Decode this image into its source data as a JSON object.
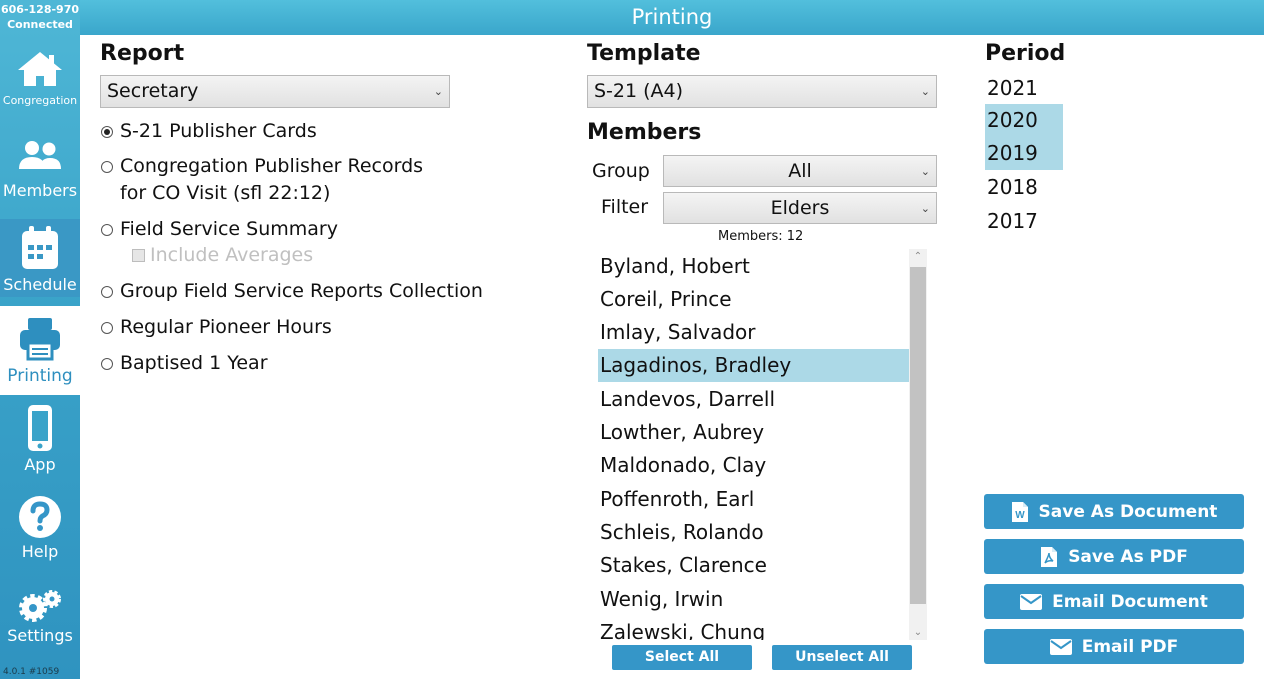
{
  "connection": {
    "id": "606-128-970",
    "status": "Connected"
  },
  "window": {
    "title": "Printing"
  },
  "nav": [
    {
      "label": "Congregation",
      "icon": "home-icon"
    },
    {
      "label": "Members",
      "icon": "people-icon"
    },
    {
      "label": "Schedule",
      "icon": "calendar-icon"
    },
    {
      "label": "Printing",
      "icon": "printer-icon",
      "active": true
    },
    {
      "label": "App",
      "icon": "phone-icon"
    },
    {
      "label": "Help",
      "icon": "help-icon"
    },
    {
      "label": "Settings",
      "icon": "gear-icon"
    }
  ],
  "version": "4.0.1 #1059",
  "report": {
    "heading": "Report",
    "selected": "Secretary",
    "options": [
      {
        "label": "S-21 Publisher Cards",
        "checked": true
      },
      {
        "label": "Congregation Publisher Records",
        "label2": "for CO Visit (sfl 22:12)",
        "checked": false
      },
      {
        "label": "Field Service Summary",
        "checked": false
      },
      {
        "label": "Group Field Service Reports Collection",
        "checked": false
      },
      {
        "label": "Regular Pioneer Hours",
        "checked": false
      },
      {
        "label": "Baptised 1 Year",
        "checked": false
      }
    ],
    "include_averages": {
      "label": "Include Averages",
      "checked": false,
      "enabled": false
    }
  },
  "template": {
    "heading": "Template",
    "selected": "S-21 (A4)"
  },
  "members": {
    "heading": "Members",
    "group_label": "Group",
    "group_value": "All",
    "filter_label": "Filter",
    "filter_value": "Elders",
    "count_text": "Members: 12",
    "list": [
      {
        "name": "Byland, Hobert",
        "selected": false
      },
      {
        "name": "Coreil, Prince",
        "selected": false
      },
      {
        "name": "Imlay, Salvador",
        "selected": false
      },
      {
        "name": "Lagadinos, Bradley",
        "selected": true
      },
      {
        "name": "Landevos, Darrell",
        "selected": false
      },
      {
        "name": "Lowther, Aubrey",
        "selected": false
      },
      {
        "name": "Maldonado, Clay",
        "selected": false
      },
      {
        "name": "Poffenroth, Earl",
        "selected": false
      },
      {
        "name": "Schleis, Rolando",
        "selected": false
      },
      {
        "name": "Stakes, Clarence",
        "selected": false
      },
      {
        "name": "Wenig, Irwin",
        "selected": false
      },
      {
        "name": "Zalewski, Chung",
        "selected": false
      }
    ],
    "select_all": "Select All",
    "unselect_all": "Unselect All"
  },
  "period": {
    "heading": "Period",
    "years": [
      {
        "label": "2021",
        "selected": false
      },
      {
        "label": "2020",
        "selected": true
      },
      {
        "label": "2019",
        "selected": true
      },
      {
        "label": "2018",
        "selected": false
      },
      {
        "label": "2017",
        "selected": false
      }
    ]
  },
  "actions": [
    {
      "label": "Save As Document",
      "icon": "word-document-icon"
    },
    {
      "label": "Save As PDF",
      "icon": "pdf-icon"
    },
    {
      "label": "Email Document",
      "icon": "envelope-icon"
    },
    {
      "label": "Email PDF",
      "icon": "envelope-icon"
    }
  ],
  "colors": {
    "accent": "#3596c8",
    "selection": "#acd9e7",
    "sidebar": "#3aa3c9"
  }
}
